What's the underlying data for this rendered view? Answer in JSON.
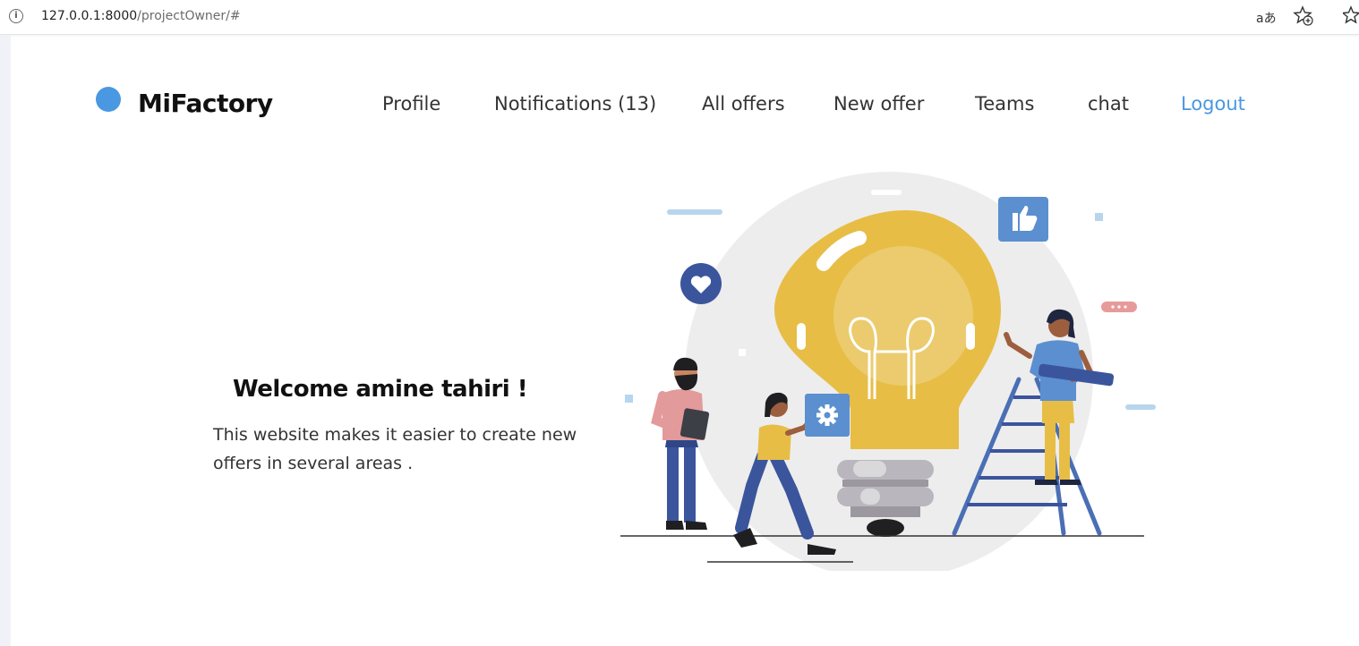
{
  "browser": {
    "url_host": "127.0.0.1:8000",
    "url_path": "/projectOwner/#",
    "read_aloud_label": "aあ",
    "icons": {
      "site_info": "info-icon",
      "read_aloud": "read-aloud-icon",
      "add_favorite": "star-plus-icon",
      "favorites": "favorites-icon"
    }
  },
  "header": {
    "brand": "MiFactory",
    "brand_color": "#4a98e2",
    "nav": {
      "profile": "Profile",
      "notifications": "Notifications (13)",
      "all_offers": "All offers",
      "new_offer": "New offer",
      "teams": "Teams",
      "chat": "chat",
      "logout": "Logout"
    }
  },
  "hero": {
    "title": "Welcome amine tahiri !",
    "description": "This website makes it easier to create new offers in several areas ."
  },
  "colors": {
    "accent": "#4a98e2",
    "bulb": "#e7bd45",
    "bulb_inner": "#ebcb6e",
    "circle_bg": "#ededed",
    "icon_badge": "#5b8fd0",
    "heart_badge": "#3b559c"
  }
}
